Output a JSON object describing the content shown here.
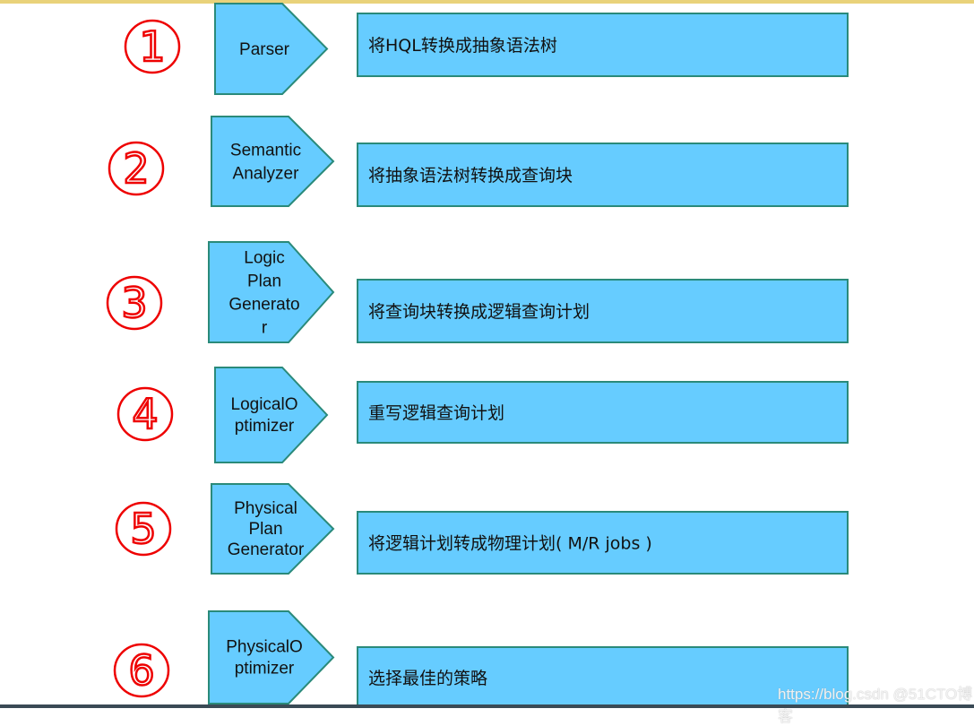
{
  "colors": {
    "shape_fill": "#66ccff",
    "shape_stroke": "#2a8a7a",
    "annotation": "#ee0000"
  },
  "steps": [
    {
      "number": "1",
      "label_lines": [
        "Parser"
      ],
      "description": "将HQL转换成抽象语法树"
    },
    {
      "number": "2",
      "label_lines": [
        "Semantic",
        "Analyzer"
      ],
      "description": "将抽象语法树转换成查询块"
    },
    {
      "number": "3",
      "label_lines": [
        "Logic",
        "Plan",
        "Generato",
        "r"
      ],
      "description": "将查询块转换成逻辑查询计划"
    },
    {
      "number": "4",
      "label_lines": [
        "LogicalO",
        "ptimizer"
      ],
      "description": "重写逻辑查询计划"
    },
    {
      "number": "5",
      "label_lines": [
        "Physical",
        "Plan",
        "Generator"
      ],
      "description": "将逻辑计划转成物理计划( M/R jobs )"
    },
    {
      "number": "6",
      "label_lines": [
        "PhysicalO",
        "ptimizer"
      ],
      "description": "选择最佳的策略"
    }
  ],
  "watermark": "https://blog.csdn @51CTO博客"
}
